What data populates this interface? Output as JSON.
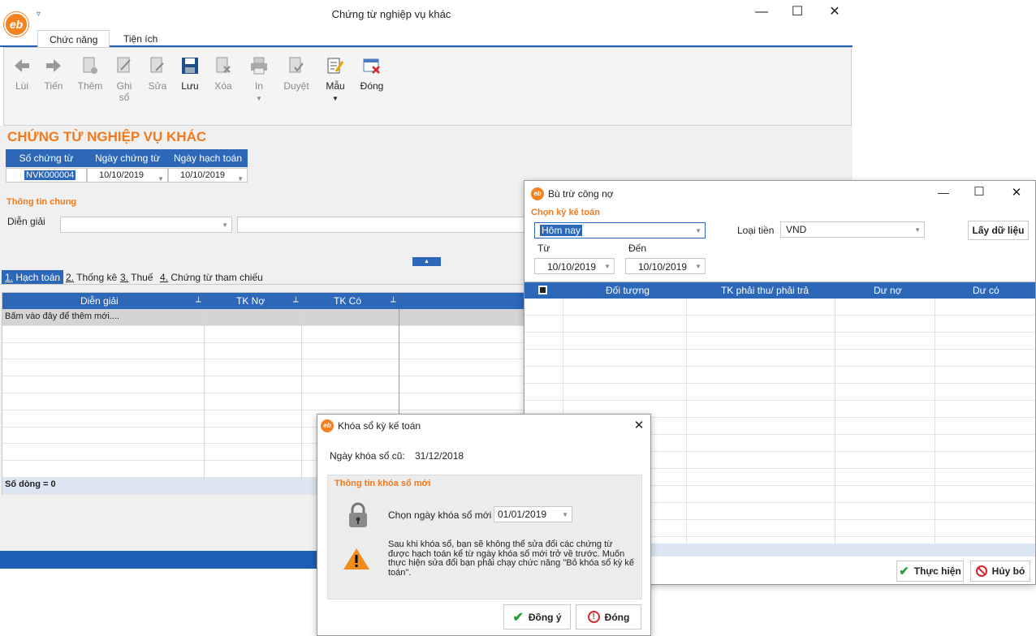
{
  "app": {
    "logo_text": "eb",
    "window_title": "Chứng từ nghiệp vụ khác",
    "ribbon_tabs": [
      "Chức năng",
      "Tiện ích"
    ],
    "toolbar": {
      "back": "Lùi",
      "forward": "Tiến",
      "add": "Thêm",
      "post_line1": "Ghi",
      "post_line2": "sổ",
      "edit": "Sửa",
      "save": "Lưu",
      "delete": "Xóa",
      "print": "In",
      "approve": "Duyệt",
      "template": "Mẫu",
      "close": "Đóng"
    }
  },
  "document": {
    "title": "CHỨNG TỪ NGHIỆP VỤ KHÁC",
    "headers": [
      "Số chứng từ",
      "Ngày chứng từ",
      "Ngày hạch toán"
    ],
    "doc_no": "NVK000004",
    "doc_date": "10/10/2019",
    "posting_date": "10/10/2019",
    "general_info_label": "Thông tin chung",
    "description_label": "Diễn giải",
    "subtabs": [
      {
        "num": "1.",
        "label": " Hạch toán"
      },
      {
        "num": "2.",
        "label": " Thống kê"
      },
      {
        "num": "3.",
        "label": " Thuế"
      },
      {
        "num": "4.",
        "label": " Chứng từ tham chiếu"
      }
    ],
    "grid_headers": [
      "Diễn giải",
      "TK Nợ",
      "TK Có"
    ],
    "grid_placeholder": "Bấm vào đây để thêm mới....",
    "footer": "Số dòng = 0"
  },
  "butru": {
    "title": "Bù trừ công nợ",
    "period_label": "Chọn kỳ kế toán",
    "period_value": "Hôm nay",
    "currency_label": "Loại tiền",
    "currency_value": "VND",
    "fetch_button": "Lấy dữ liệu",
    "from_label": "Từ",
    "to_label": "Đến",
    "from_date": "10/10/2019",
    "to_date": "10/10/2019",
    "grid_headers": [
      "Đối tượng",
      "TK phải thu/ phải trả",
      "Dư nợ",
      "Dư có"
    ],
    "execute_button": "Thực hiện",
    "cancel_button": "Hủy bỏ"
  },
  "khoaso": {
    "title": "Khóa sổ kỳ kế toán",
    "old_date_label": "Ngày khóa sổ cũ:",
    "old_date": "31/12/2018",
    "section_label": "Thông tin khóa sổ mới",
    "new_date_label": "Chọn ngày khóa sổ mới",
    "new_date": "01/01/2019",
    "warning": "Sau khi khóa sổ, bạn sẽ không thể sửa đổi các chứng từ được hạch toán kể từ ngày khóa sổ mới trở về trước. Muốn thực hiện sửa đổi bạn phải chạy chức năng \"Bỏ khóa sổ kỳ kế toán\".",
    "agree_button": "Đồng ý",
    "close_button": "Đóng"
  },
  "colors": {
    "accent": "#2c67b8",
    "orange": "#f07a1f"
  }
}
